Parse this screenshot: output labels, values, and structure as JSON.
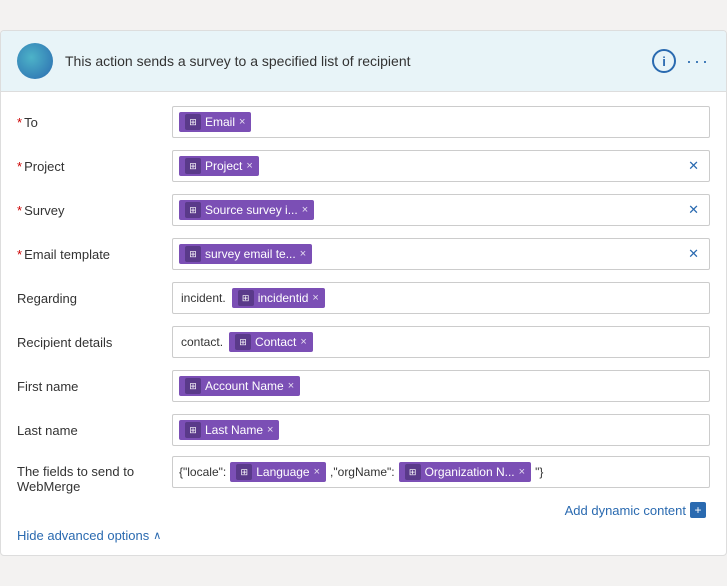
{
  "header": {
    "description": "This action sends a survey to a specified list of recipient",
    "info_icon_label": "i",
    "more_icon_label": "···"
  },
  "fields": {
    "to": {
      "label": "To",
      "required": true,
      "tags": [
        {
          "label": "Email",
          "icon": "db"
        }
      ],
      "has_x": false
    },
    "project": {
      "label": "Project",
      "required": true,
      "tags": [
        {
          "label": "Project",
          "icon": "db"
        }
      ],
      "has_x": true
    },
    "survey": {
      "label": "Survey",
      "required": true,
      "tags": [
        {
          "label": "Source survey i...",
          "icon": "db"
        }
      ],
      "has_x": true
    },
    "email_template": {
      "label": "Email template",
      "required": true,
      "tags": [
        {
          "label": "survey email te...",
          "icon": "db"
        }
      ],
      "has_x": true
    },
    "regarding": {
      "label": "Regarding",
      "required": false,
      "prefix": "incident.",
      "tags": [
        {
          "label": "incidentid",
          "icon": "db"
        }
      ],
      "has_x": false
    },
    "recipient_details": {
      "label": "Recipient details",
      "required": false,
      "prefix": "contact.",
      "tags": [
        {
          "label": "Contact",
          "icon": "db"
        }
      ],
      "has_x": false
    },
    "first_name": {
      "label": "First name",
      "required": false,
      "tags": [
        {
          "label": "Account Name",
          "icon": "db"
        }
      ],
      "has_x": false
    },
    "last_name": {
      "label": "Last name",
      "required": false,
      "tags": [
        {
          "label": "Last Name",
          "icon": "db"
        }
      ],
      "has_x": false
    },
    "webmerge": {
      "label": "The fields to send to WebMerge",
      "required": false,
      "prefix1": "{\"locale\":",
      "tag1": {
        "label": "Language",
        "icon": "db"
      },
      "prefix2": ",\"orgName\":",
      "tag2": {
        "label": "Organization N...",
        "icon": "db"
      },
      "suffix": " \"}"
    }
  },
  "actions": {
    "add_dynamic_label": "Add dynamic content",
    "plus_label": "+",
    "hide_advanced_label": "Hide advanced options",
    "chevron_label": "∧"
  }
}
